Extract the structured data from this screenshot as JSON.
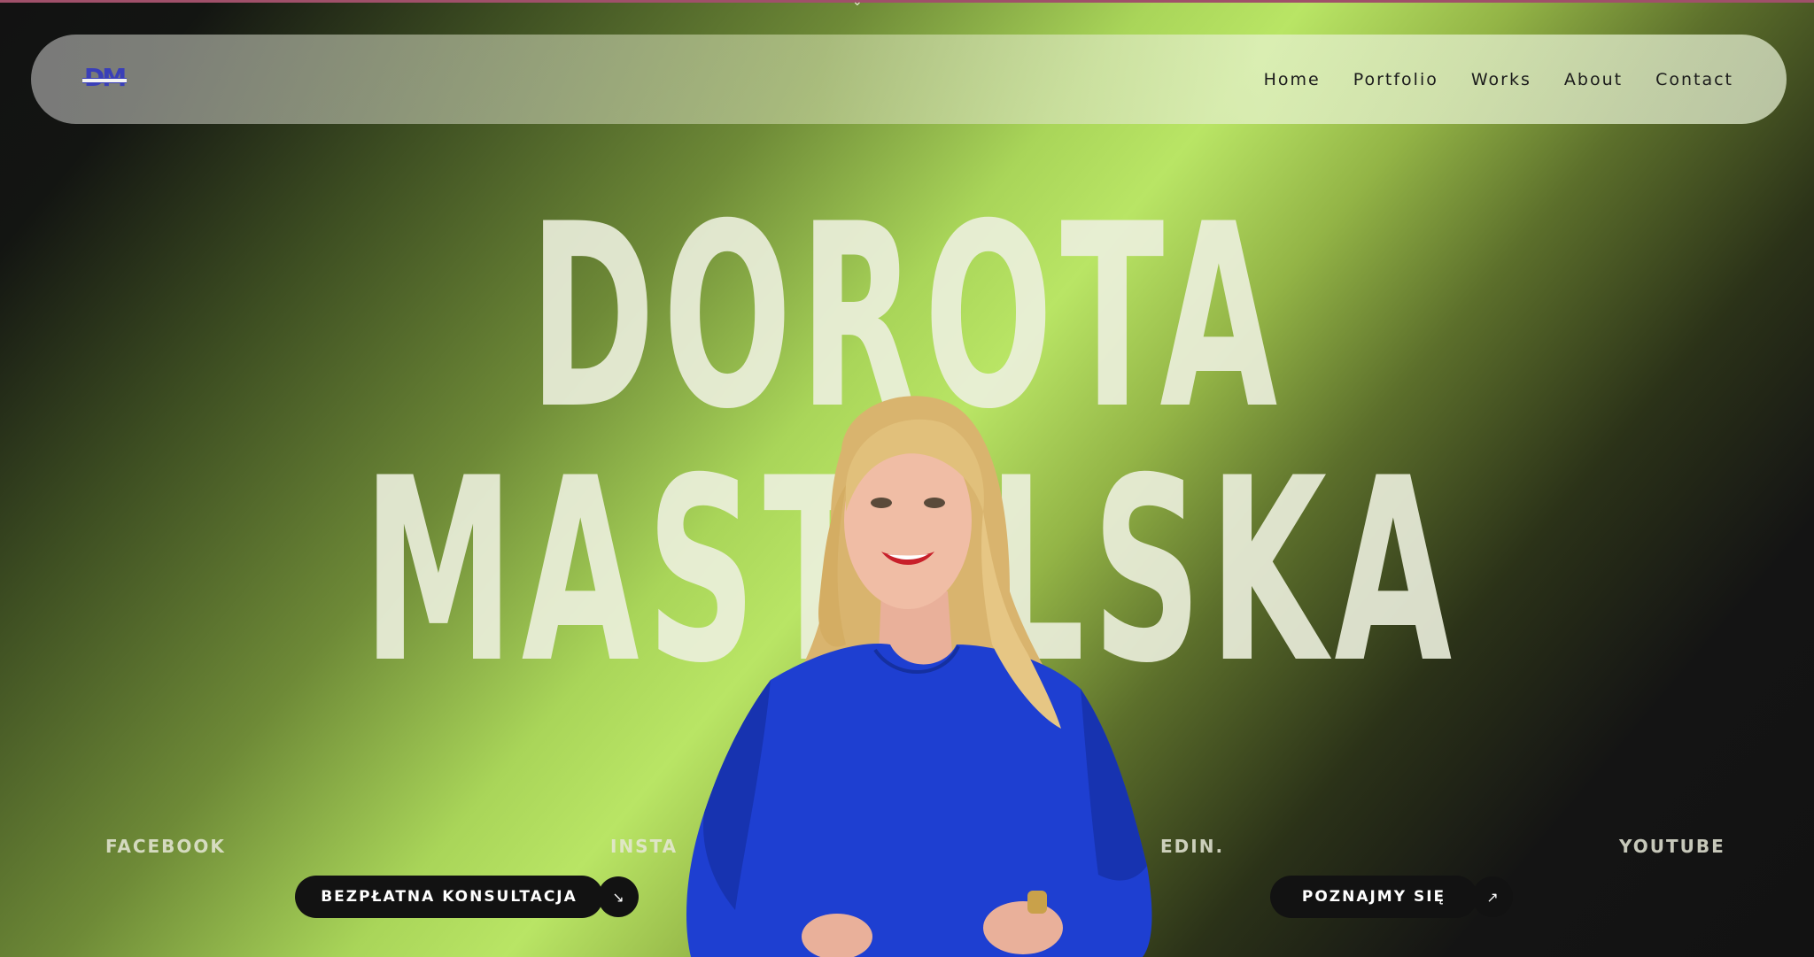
{
  "nav": {
    "logo_alt": "DM logo",
    "logo_letters": "DM",
    "links": [
      "Home",
      "Portfolio",
      "Works",
      "About",
      "Contact"
    ]
  },
  "hero": {
    "first_name": "DOROTA",
    "last_name": "MASTALSKA"
  },
  "social": {
    "facebook": "FACEBOOK",
    "instagram": "INSTA",
    "linkedin": "EDIN.",
    "youtube": "YOUTUBE"
  },
  "cta": {
    "consultation": "BEZPŁATNA KONSULTACJA",
    "meet": "POZNAJMY SIĘ"
  },
  "colors": {
    "accent_green": "#b9e565",
    "dark": "#121212",
    "dress_blue": "#1e3fd1",
    "logo_blue": "#3a3fb8"
  },
  "icons": {
    "consultation_arrow": "arrow-down-right-icon",
    "meet_arrow": "arrow-up-right-icon"
  }
}
